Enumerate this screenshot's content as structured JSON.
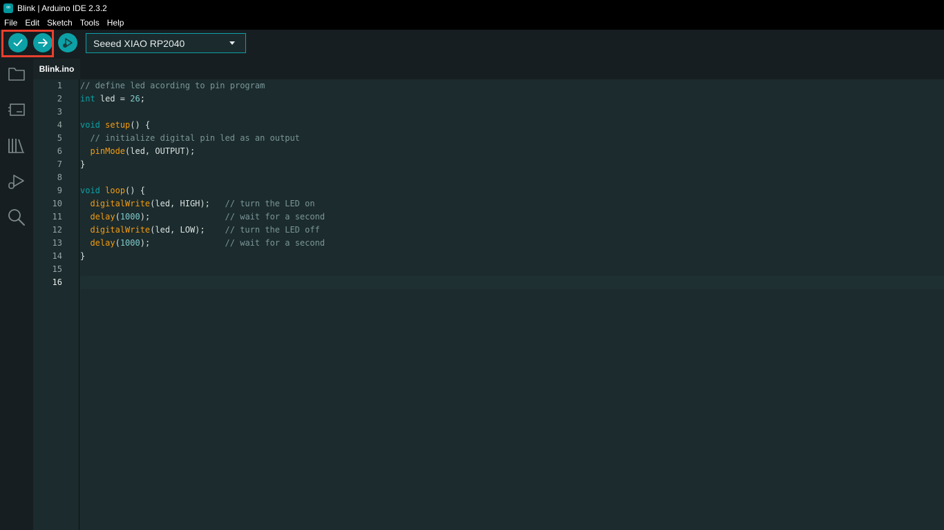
{
  "window": {
    "title": "Blink | Arduino IDE 2.3.2",
    "logo_glyph": "∞"
  },
  "menu": [
    "File",
    "Edit",
    "Sketch",
    "Tools",
    "Help"
  ],
  "toolbar": {
    "verify_icon": "check-icon",
    "upload_icon": "arrow-right-icon",
    "debug_icon": "debug-play-icon",
    "board": "Seeed XIAO RP2040"
  },
  "activity_bar": [
    "folder-icon",
    "board-manager-icon",
    "library-icon",
    "debug-icon",
    "search-icon"
  ],
  "tabs": [
    {
      "label": "Blink.ino"
    }
  ],
  "editor": {
    "active_line": 16,
    "line_numbers": [
      "1",
      "2",
      "3",
      "4",
      "5",
      "6",
      "7",
      "8",
      "9",
      "10",
      "11",
      "12",
      "13",
      "14",
      "15",
      "16"
    ],
    "lines": [
      [
        {
          "t": "// define led acording to pin program",
          "c": "cm"
        }
      ],
      [
        {
          "t": "int",
          "c": "kw"
        },
        {
          "t": " led = ",
          "c": ""
        },
        {
          "t": "26",
          "c": "num"
        },
        {
          "t": ";",
          "c": ""
        }
      ],
      [],
      [
        {
          "t": "void",
          "c": "kw"
        },
        {
          "t": " ",
          "c": ""
        },
        {
          "t": "setup",
          "c": "fn"
        },
        {
          "t": "() {",
          "c": ""
        }
      ],
      [
        {
          "t": "  ",
          "c": ""
        },
        {
          "t": "// initialize digital pin led as an output",
          "c": "cm"
        }
      ],
      [
        {
          "t": "  ",
          "c": ""
        },
        {
          "t": "pinMode",
          "c": "fn"
        },
        {
          "t": "(led, OUTPUT);",
          "c": ""
        }
      ],
      [
        {
          "t": "}",
          "c": ""
        }
      ],
      [],
      [
        {
          "t": "void",
          "c": "kw"
        },
        {
          "t": " ",
          "c": ""
        },
        {
          "t": "loop",
          "c": "fn"
        },
        {
          "t": "() {",
          "c": ""
        }
      ],
      [
        {
          "t": "  ",
          "c": ""
        },
        {
          "t": "digitalWrite",
          "c": "fn"
        },
        {
          "t": "(led, HIGH);   ",
          "c": ""
        },
        {
          "t": "// turn the LED on",
          "c": "cm"
        }
      ],
      [
        {
          "t": "  ",
          "c": ""
        },
        {
          "t": "delay",
          "c": "fn"
        },
        {
          "t": "(",
          "c": ""
        },
        {
          "t": "1000",
          "c": "num"
        },
        {
          "t": ");               ",
          "c": ""
        },
        {
          "t": "// wait for a second",
          "c": "cm"
        }
      ],
      [
        {
          "t": "  ",
          "c": ""
        },
        {
          "t": "digitalWrite",
          "c": "fn"
        },
        {
          "t": "(led, LOW);    ",
          "c": ""
        },
        {
          "t": "// turn the LED off",
          "c": "cm"
        }
      ],
      [
        {
          "t": "  ",
          "c": ""
        },
        {
          "t": "delay",
          "c": "fn"
        },
        {
          "t": "(",
          "c": ""
        },
        {
          "t": "1000",
          "c": "num"
        },
        {
          "t": ");               ",
          "c": ""
        },
        {
          "t": "// wait for a second",
          "c": "cm"
        }
      ],
      [
        {
          "t": "}",
          "c": ""
        }
      ],
      [],
      []
    ]
  },
  "colors": {
    "accent": "#0ca1a6",
    "highlight_box": "#e8402e",
    "editor_bg": "#1c2b2d",
    "keyword": "#0ca1a6",
    "function": "#f39c12",
    "comment": "#7a9698"
  }
}
